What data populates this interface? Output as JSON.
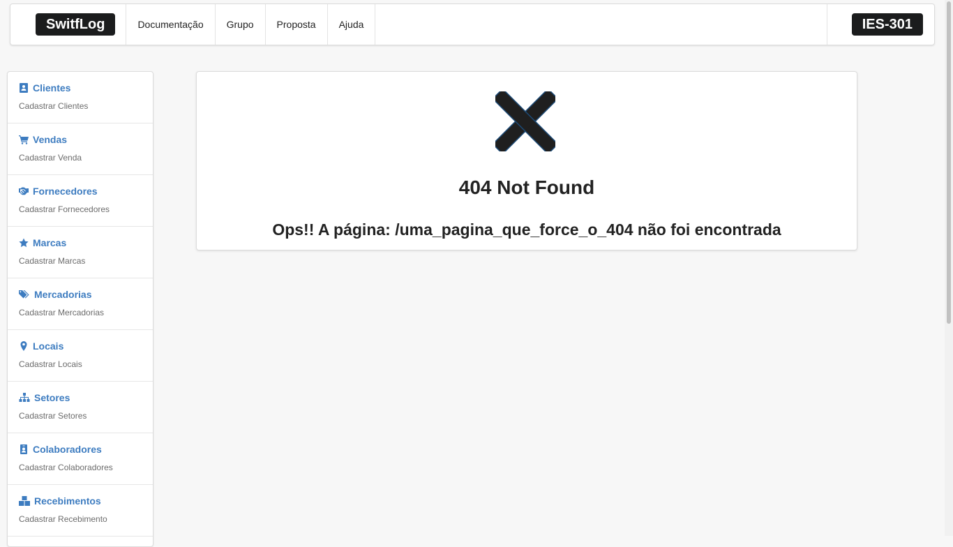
{
  "header": {
    "brand": "SwitfLog",
    "nav": [
      "Documentação",
      "Grupo",
      "Proposta",
      "Ajuda"
    ],
    "course_badge": "IES-301"
  },
  "sidebar": {
    "accent_color": "#3d7cc0",
    "items": [
      {
        "icon": "address-book-icon",
        "label": "Clientes",
        "sub": "Cadastrar Clientes"
      },
      {
        "icon": "cart-icon",
        "label": "Vendas",
        "sub": "Cadastrar Venda"
      },
      {
        "icon": "handshake-icon",
        "label": "Fornecedores",
        "sub": "Cadastrar Fornecedores"
      },
      {
        "icon": "star-icon",
        "label": "Marcas",
        "sub": "Cadastrar Marcas"
      },
      {
        "icon": "tags-icon",
        "label": "Mercadorias",
        "sub": "Cadastrar Mercadorias"
      },
      {
        "icon": "map-pin-icon",
        "label": "Locais",
        "sub": "Cadastrar Locais"
      },
      {
        "icon": "sitemap-icon",
        "label": "Setores",
        "sub": "Cadastrar Setores"
      },
      {
        "icon": "id-badge-icon",
        "label": "Colaboradores",
        "sub": "Cadastrar Colaboradores"
      },
      {
        "icon": "boxes-icon",
        "label": "Recebimentos",
        "sub": "Cadastrar Recebimento"
      }
    ]
  },
  "error": {
    "icon": "close-icon",
    "title": "404 Not Found",
    "message": "Ops!! A página: /uma_pagina_que_force_o_404 não foi encontrada"
  }
}
